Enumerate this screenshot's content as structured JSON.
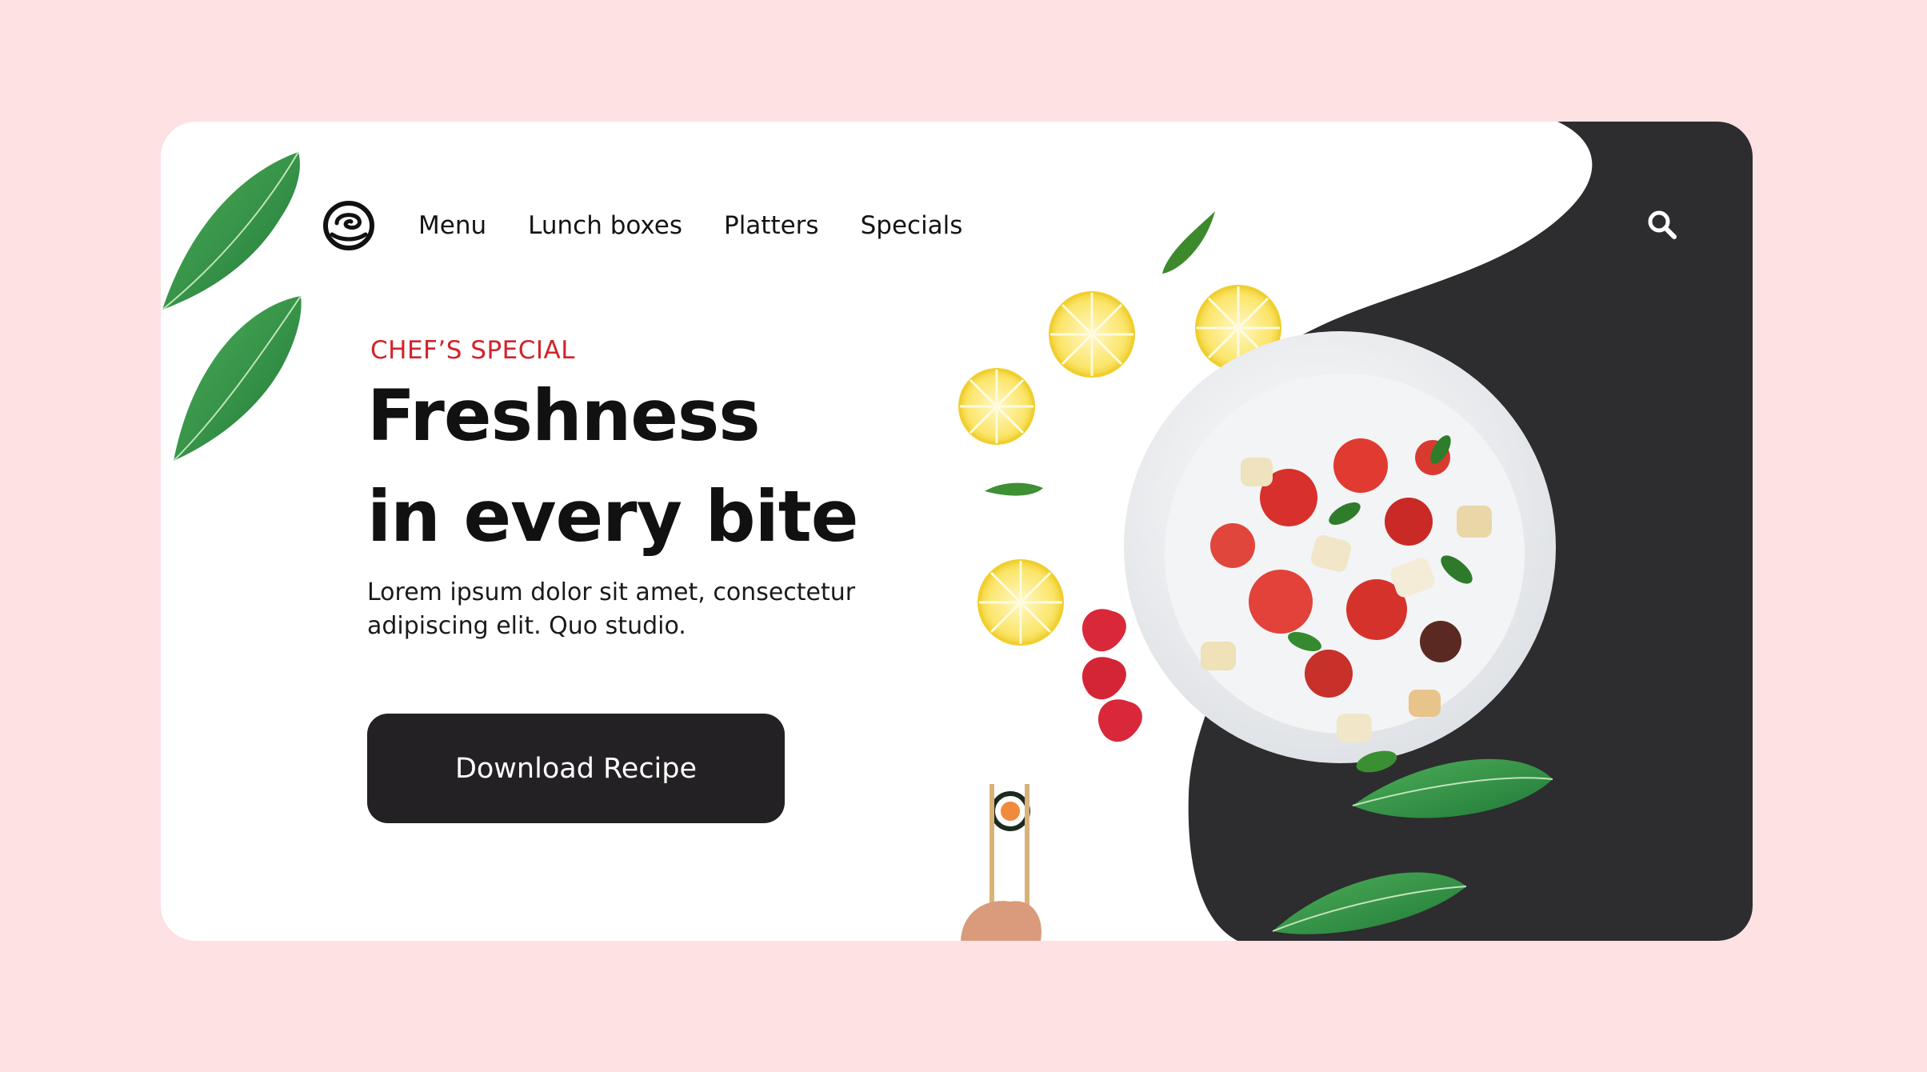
{
  "brand": {
    "logo_icon": "sushi-roll-logo-icon"
  },
  "nav": {
    "items": [
      {
        "label": "Menu"
      },
      {
        "label": "Lunch boxes"
      },
      {
        "label": "Platters"
      },
      {
        "label": "Specials"
      }
    ],
    "search_icon": "search-icon"
  },
  "hero": {
    "eyebrow": "CHEF’S SPECIAL",
    "headline_line1": "Freshness",
    "headline_line2": "in every bite",
    "body_line1": "Lorem ipsum dolor sit amet, consectetur",
    "body_line2": "adipiscing elit. Quo studio.",
    "cta_label": "Download Recipe"
  },
  "colors": {
    "page_background": "#fde1e3",
    "card_background": "#ffffff",
    "dark_accent": "#2d2c2e",
    "eyebrow_red": "#d2232a",
    "button_background": "#232123",
    "text_primary": "#111111"
  }
}
